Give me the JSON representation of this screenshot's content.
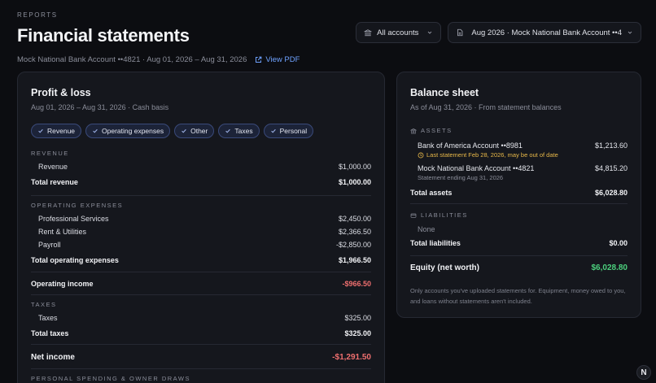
{
  "header": {
    "eyebrow": "REPORTS",
    "title": "Financial statements",
    "subline": "Mock National Bank Account ••4821 · Aug 01, 2026 – Aug 31, 2026",
    "view_pdf": "View PDF"
  },
  "controls": {
    "accounts_label": "All accounts",
    "statement_label": "Aug 2026 · Mock National Bank Account ••4"
  },
  "pl": {
    "title": "Profit & loss",
    "subtitle": "Aug 01, 2026 – Aug 31, 2026 · Cash basis",
    "filters": [
      "Revenue",
      "Operating expenses",
      "Other",
      "Taxes",
      "Personal"
    ],
    "revenue": {
      "label": "REVENUE",
      "rows": [
        {
          "name": "Revenue",
          "amount": "$1,000.00"
        }
      ],
      "total_label": "Total revenue",
      "total": "$1,000.00"
    },
    "opex": {
      "label": "OPERATING EXPENSES",
      "rows": [
        {
          "name": "Professional Services",
          "amount": "$2,450.00"
        },
        {
          "name": "Rent & Utilities",
          "amount": "$2,366.50"
        },
        {
          "name": "Payroll",
          "amount": "-$2,850.00"
        }
      ],
      "total_label": "Total operating expenses",
      "total": "$1,966.50"
    },
    "operating_income_label": "Operating income",
    "operating_income": "-$966.50",
    "taxes": {
      "label": "TAXES",
      "rows": [
        {
          "name": "Taxes",
          "amount": "$325.00"
        }
      ],
      "total_label": "Total taxes",
      "total": "$325.00"
    },
    "net_income_label": "Net income",
    "net_income": "-$1,291.50",
    "personal_label": "PERSONAL SPENDING & OWNER DRAWS"
  },
  "bs": {
    "title": "Balance sheet",
    "subtitle": "As of Aug 31, 2026 · From statement balances",
    "assets_label": "ASSETS",
    "assets": [
      {
        "name": "Bank of America Account ••8981",
        "note": "Last statement Feb 28, 2026, may be out of date",
        "amount": "$1,213.60"
      },
      {
        "name": "Mock National Bank Account ••4821",
        "note": "Statement ending Aug 31, 2026",
        "amount": "$4,815.20"
      }
    ],
    "total_assets_label": "Total assets",
    "total_assets": "$6,028.80",
    "liabilities_label": "LIABILITIES",
    "liabilities_none": "None",
    "total_liabilities_label": "Total liabilities",
    "total_liabilities": "$0.00",
    "equity_label": "Equity (net worth)",
    "equity": "$6,028.80",
    "footnote": "Only accounts you've uploaded statements for. Equipment, money owed to you, and loans without statements aren't included."
  },
  "corner_badge": "N",
  "colors": {
    "accent": "#6fa2ff",
    "negative": "#ef6f6f",
    "positive": "#4cd07d",
    "warning": "#e9b949"
  },
  "icons": {
    "accounts": "bank-icon",
    "statement": "document-icon",
    "view_pdf": "external-link-icon",
    "chip": "check-icon"
  }
}
